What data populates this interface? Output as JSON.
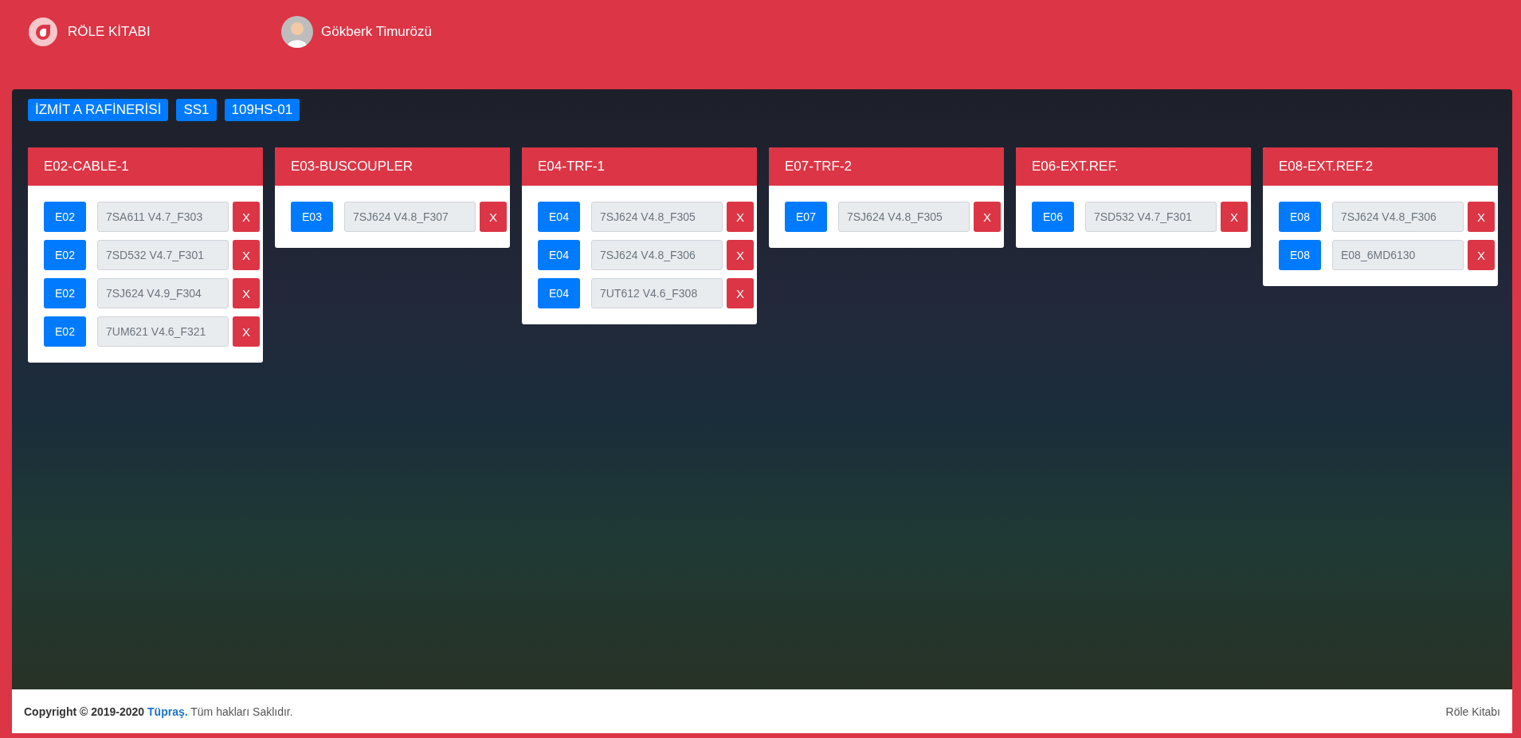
{
  "header": {
    "app_title": "RÖLE KİTABI",
    "user_name": "Gökberk Timurözü"
  },
  "breadcrumb": [
    "İZMİT A RAFİNERİSİ",
    "SS1",
    "109HS-01"
  ],
  "panels": [
    {
      "title": "E02-CABLE-1",
      "rows": [
        {
          "code": "E02",
          "device": "7SA611 V4.7_F303",
          "remove": "X"
        },
        {
          "code": "E02",
          "device": "7SD532 V4.7_F301",
          "remove": "X"
        },
        {
          "code": "E02",
          "device": "7SJ624 V4.9_F304",
          "remove": "X"
        },
        {
          "code": "E02",
          "device": "7UM621 V4.6_F321",
          "remove": "X"
        }
      ]
    },
    {
      "title": "E03-BUSCOUPLER",
      "rows": [
        {
          "code": "E03",
          "device": "7SJ624 V4.8_F307",
          "remove": "X"
        }
      ]
    },
    {
      "title": "E04-TRF-1",
      "rows": [
        {
          "code": "E04",
          "device": "7SJ624 V4.8_F305",
          "remove": "X"
        },
        {
          "code": "E04",
          "device": "7SJ624 V4.8_F306",
          "remove": "X"
        },
        {
          "code": "E04",
          "device": "7UT612 V4.6_F308",
          "remove": "X"
        }
      ]
    },
    {
      "title": "E07-TRF-2",
      "rows": [
        {
          "code": "E07",
          "device": "7SJ624 V4.8_F305",
          "remove": "X"
        }
      ]
    },
    {
      "title": "E06-EXT.REF.",
      "rows": [
        {
          "code": "E06",
          "device": "7SD532 V4.7_F301",
          "remove": "X"
        }
      ]
    },
    {
      "title": "E08-EXT.REF.2",
      "rows": [
        {
          "code": "E08",
          "device": "7SJ624 V4.8_F306",
          "remove": "X"
        },
        {
          "code": "E08",
          "device": "E08_6MD6130",
          "remove": "X"
        }
      ]
    }
  ],
  "footer": {
    "copyright": "Copyright © 2019-2020",
    "company_link": "Tüpraş.",
    "rights": "Tüm hakları Saklıdır.",
    "brand": "Röle Kitabı"
  }
}
